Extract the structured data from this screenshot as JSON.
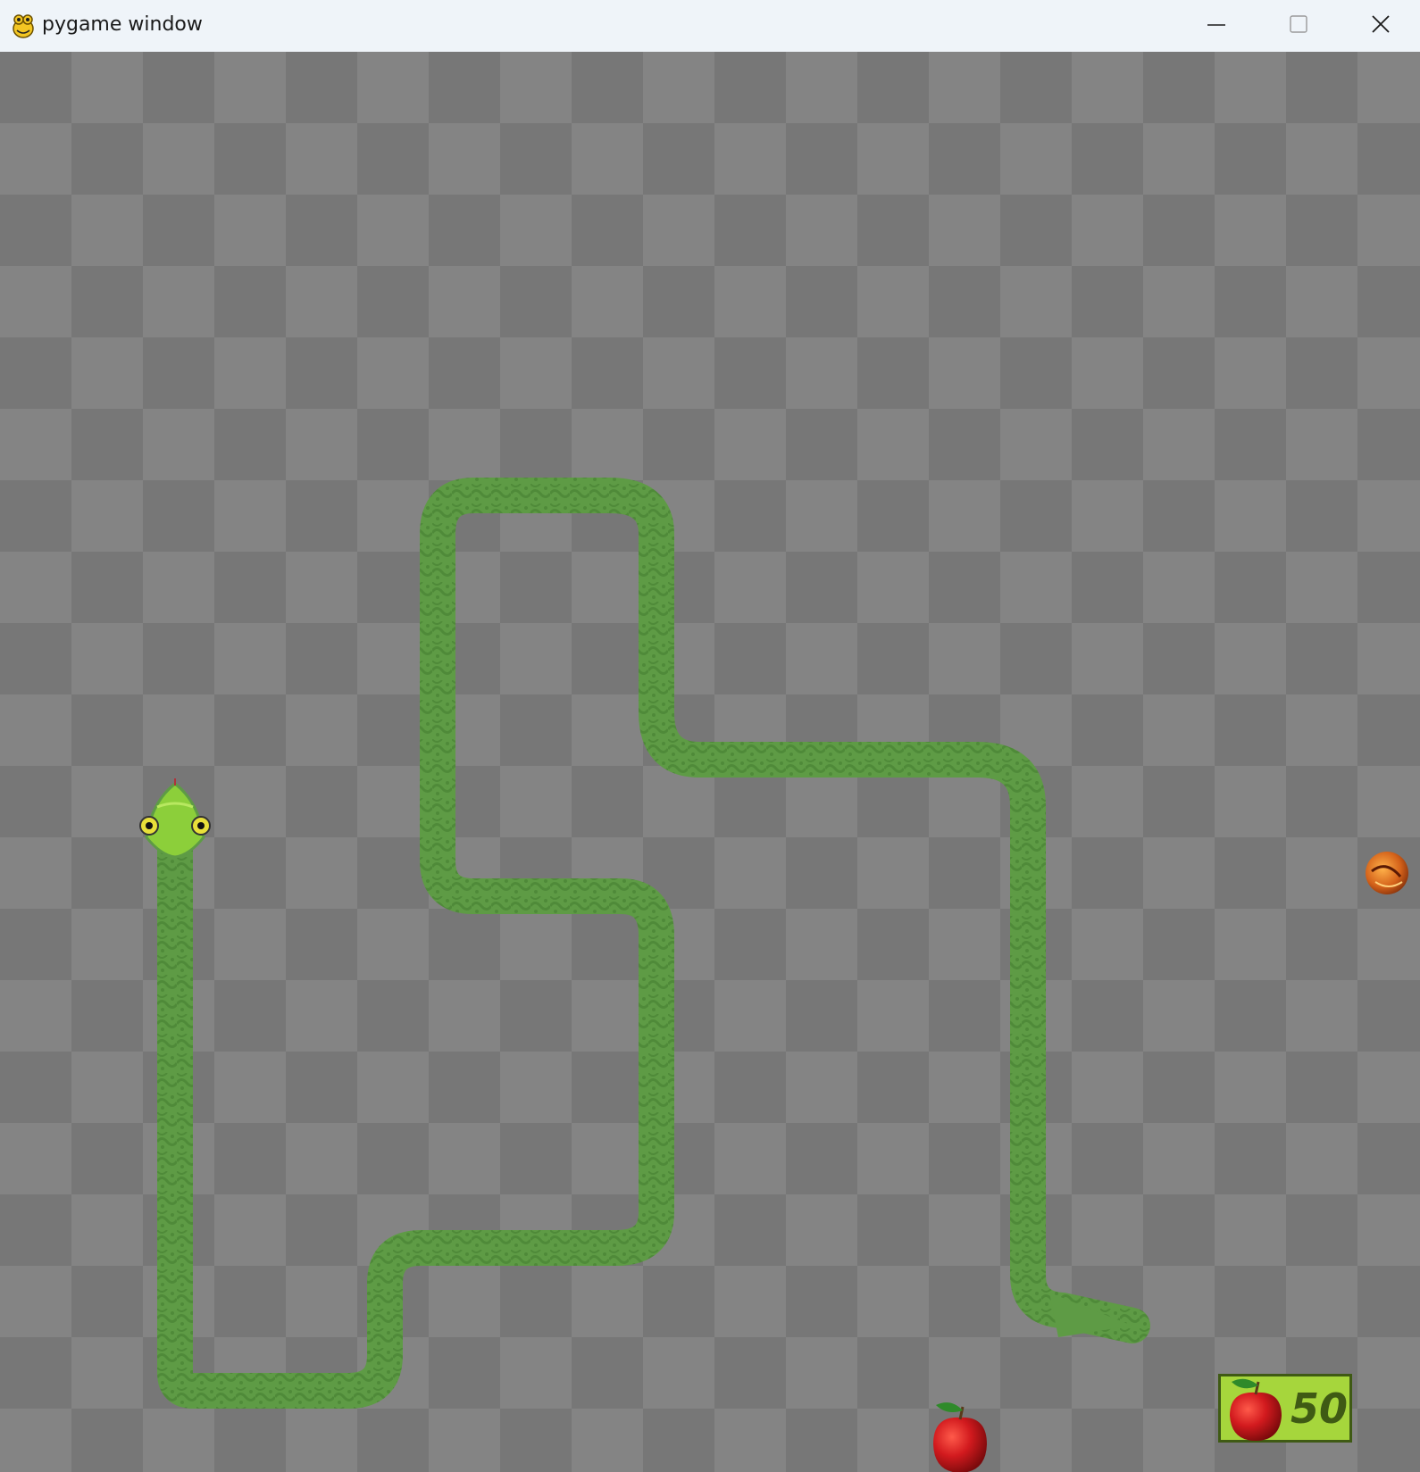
{
  "window": {
    "title": "pygame window",
    "icon": "pygame-snake-icon"
  },
  "controls": {
    "minimize": "minimize-icon",
    "maximize": "maximize-icon",
    "close": "close-icon"
  },
  "colors": {
    "board_dark": "#777777",
    "board_light": "#848484",
    "snake_body": "#5e9b45",
    "snake_pattern": "#4f8a39",
    "snake_head": "#8ccf3a",
    "apple": "#c8141a",
    "score_panel": "#a6d63c"
  },
  "score": {
    "icon": "apple-icon",
    "value": "50"
  },
  "items": {
    "apple": "apple-icon",
    "bonus": "orange-fruit-icon"
  }
}
